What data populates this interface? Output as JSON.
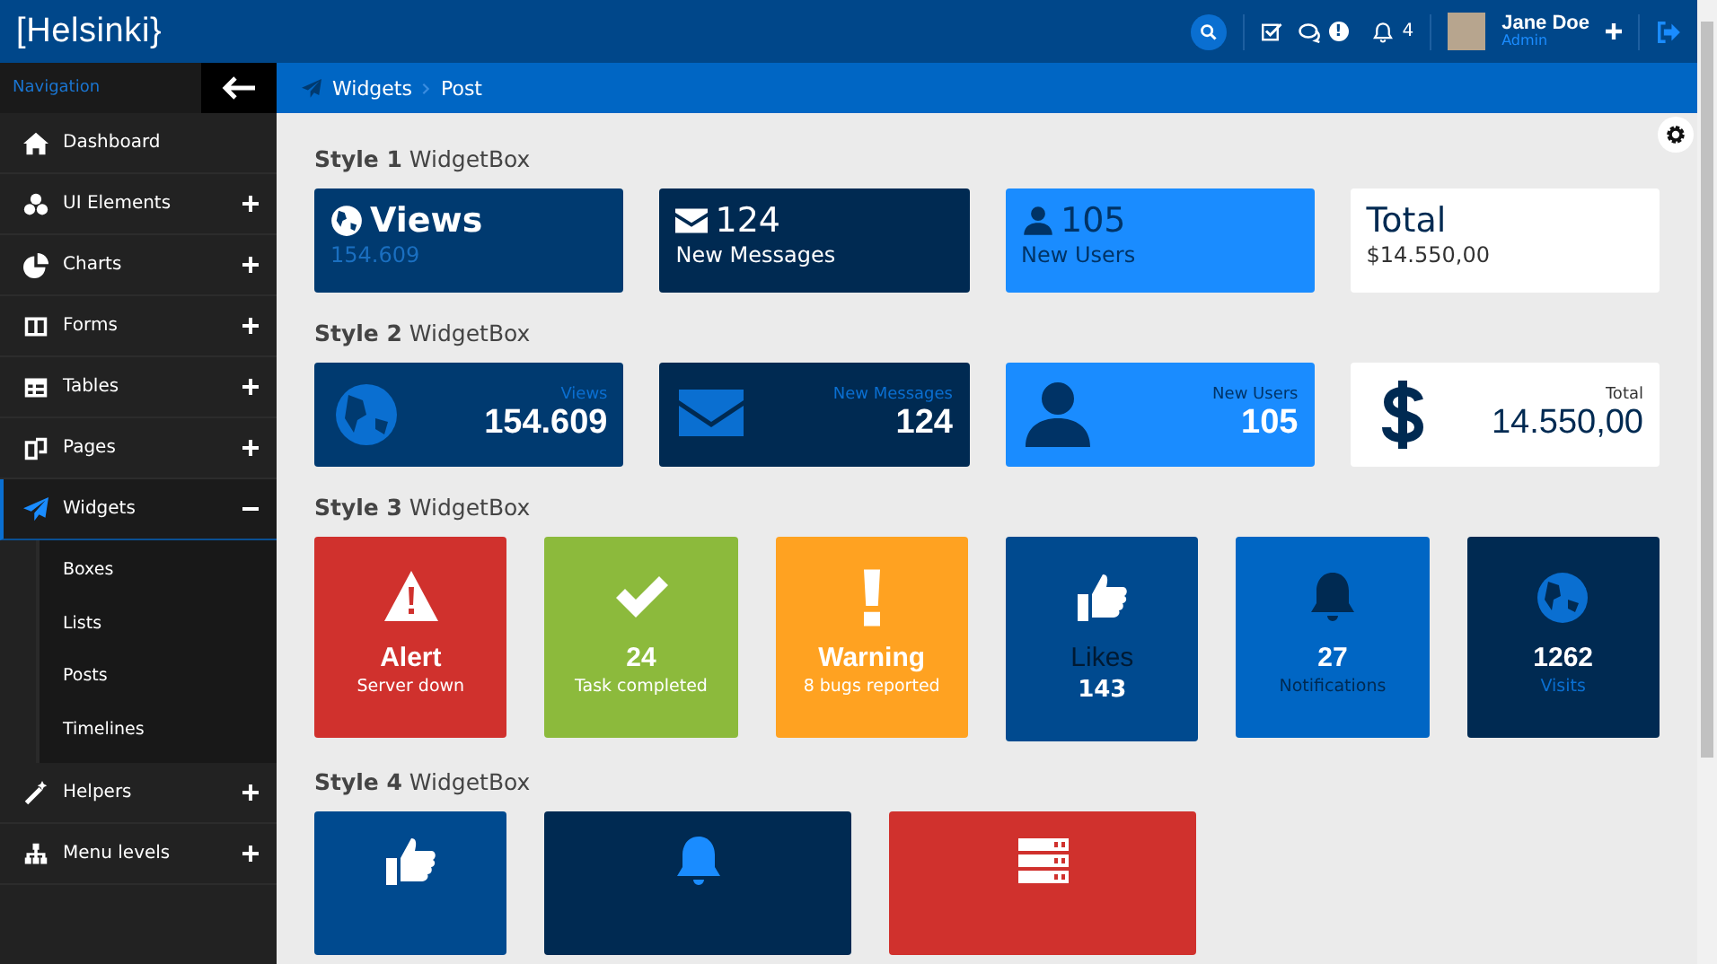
{
  "header": {
    "logo": "[Helsinki}",
    "messages_badge": "!",
    "notifications_count": "4",
    "user": {
      "name": "Jane Doe",
      "role": "Admin"
    }
  },
  "sidebar": {
    "title": "Navigation",
    "items": [
      {
        "label": "Dashboard",
        "selected": false
      },
      {
        "label": "UI Elements",
        "expanded": false,
        "selected": false
      },
      {
        "label": "Charts",
        "expanded": false,
        "selected": false
      },
      {
        "label": "Forms",
        "expanded": false,
        "selected": false
      },
      {
        "label": "Tables",
        "expanded": false,
        "selected": false
      },
      {
        "label": "Pages",
        "expanded": false,
        "selected": false
      },
      {
        "label": "Widgets",
        "expanded": true,
        "selected": true,
        "children": [
          {
            "label": "Boxes",
            "selected": false
          },
          {
            "label": "Lists",
            "selected": false
          },
          {
            "label": "Posts",
            "selected": false
          },
          {
            "label": "Timelines",
            "selected": false
          }
        ]
      },
      {
        "label": "Helpers",
        "expanded": false,
        "selected": false
      },
      {
        "label": "Menu levels",
        "expanded": false,
        "selected": false
      }
    ]
  },
  "breadcrumb": [
    "Widgets",
    "Post"
  ],
  "sections": [
    {
      "title": "**Style 1** WidgetBox",
      "kind": "style1",
      "boxes": [
        {
          "title": "Views",
          "subtitle": "154.609",
          "color": "#003a70"
        },
        {
          "title": "124",
          "subtitle": "New Messages",
          "color": "#002a52"
        },
        {
          "title": "105",
          "subtitle": "New Users",
          "color": "#1a8cff"
        },
        {
          "title": "Total",
          "subtitle": "$14.550,00",
          "color": "#ffffff"
        }
      ]
    },
    {
      "title": "**Style 2** WidgetBox",
      "kind": "style2",
      "boxes": [
        {
          "title": "Views",
          "subtitle": "154.609",
          "color": "#003a70"
        },
        {
          "title": "New Messages",
          "subtitle": "124",
          "color": "#002a52"
        },
        {
          "title": "New Users",
          "subtitle": "105",
          "color": "#1a8cff"
        },
        {
          "title": "Total",
          "subtitle": "14.550,00",
          "color": "#ffffff"
        }
      ]
    },
    {
      "title": "**Style 3** WidgetBox",
      "kind": "style3",
      "boxes": [
        {
          "title": "Alert",
          "subtitle": "Server down",
          "color": "#d0312d"
        },
        {
          "title": "24",
          "subtitle": "Task completed",
          "color": "#8cba3c"
        },
        {
          "title": "Warning",
          "subtitle": "8 bugs reported",
          "color": "#ffa221"
        },
        {
          "title": "Likes",
          "subtitle": "143",
          "color": "#004a8f"
        },
        {
          "title": "27",
          "subtitle": "Notifications",
          "color": "#0066c4"
        },
        {
          "title": "1262",
          "subtitle": "Visits",
          "color": "#002a52"
        }
      ]
    },
    {
      "title": "**Style 4** WidgetBox",
      "kind": "style4",
      "boxes": [
        {
          "color": "#004a8f"
        },
        {
          "color": "#002a52"
        },
        {
          "color": "#d0312d"
        }
      ]
    }
  ]
}
